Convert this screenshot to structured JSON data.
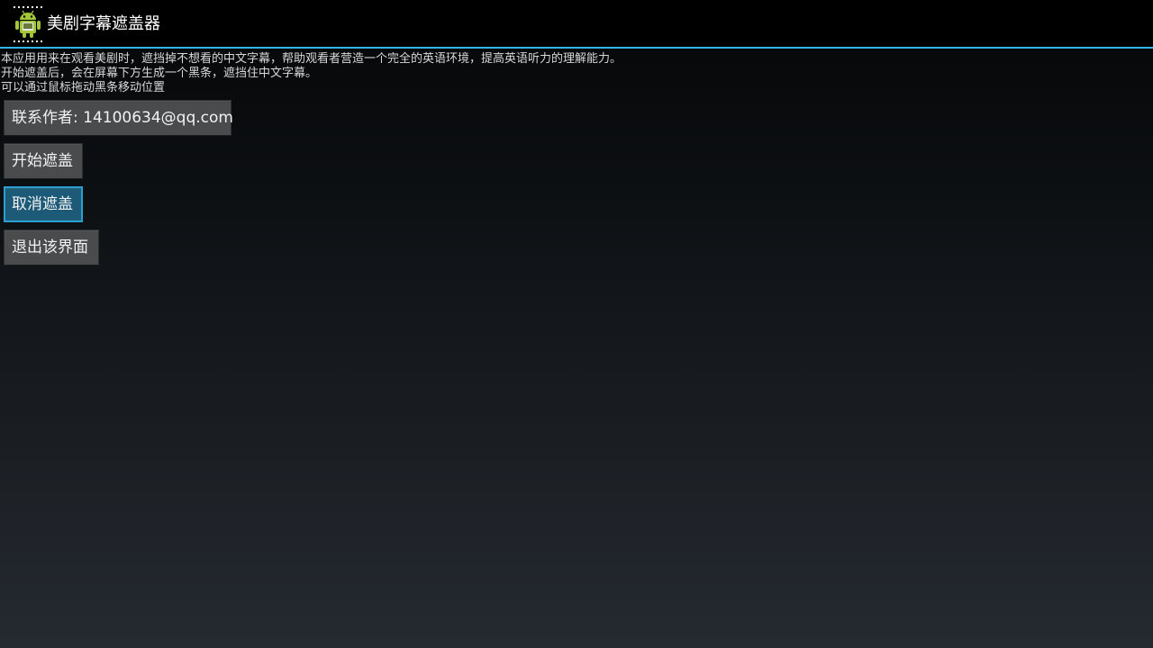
{
  "action_bar": {
    "title": "美剧字幕遮盖器",
    "icon": "android-film-icon",
    "accent_color": "#33b5e5"
  },
  "description": {
    "lines": [
      "本应用用来在观看美剧时，遮挡掉不想看的中文字幕，帮助观看者营造一个完全的英语环境，提高英语听力的理解能力。",
      "开始遮盖后，会在屏幕下方生成一个黑条，遮挡住中文字幕。",
      "可以通过鼠标拖动黑条移动位置"
    ]
  },
  "buttons": {
    "contact": "联系作者: 14100634@qq.com",
    "start": "开始遮盖",
    "cancel": "取消遮盖",
    "exit": "退出该界面"
  }
}
